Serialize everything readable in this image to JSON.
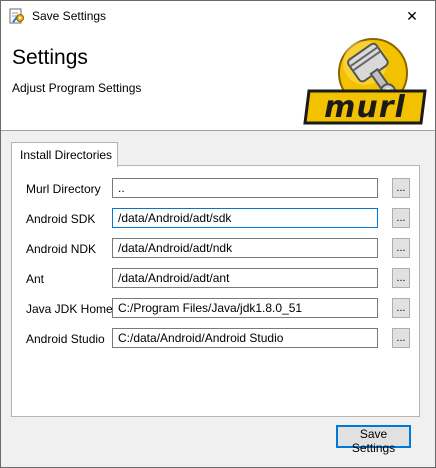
{
  "window": {
    "title": "Save Settings",
    "close_glyph": "✕"
  },
  "header": {
    "title": "Settings",
    "subtitle": "Adjust Program Settings",
    "logo_text": "murl"
  },
  "tabs": [
    {
      "label": "Install Directories",
      "selected": true
    }
  ],
  "fields": [
    {
      "label": "Murl Directory",
      "value": "..",
      "browse": "..."
    },
    {
      "label": "Android SDK",
      "value": "/data/Android/adt/sdk",
      "browse": "..."
    },
    {
      "label": "Android NDK",
      "value": "/data/Android/adt/ndk",
      "browse": "..."
    },
    {
      "label": "Ant",
      "value": "/data/Android/adt/ant",
      "browse": "..."
    },
    {
      "label": "Java JDK Home",
      "value": "C:/Program Files/Java/jdk1.8.0_51",
      "browse": "..."
    },
    {
      "label": "Android Studio",
      "value": "C:/data/Android/Android Studio",
      "browse": "..."
    }
  ],
  "footer": {
    "save_label": "Save Settings"
  },
  "colors": {
    "accent": "#0078d7",
    "logo_yellow": "#f2c200",
    "logo_dark": "#1a1a1a"
  },
  "icons": {
    "app": "gear-document-icon",
    "close": "close-icon",
    "logo": "murl-piston-logo"
  }
}
